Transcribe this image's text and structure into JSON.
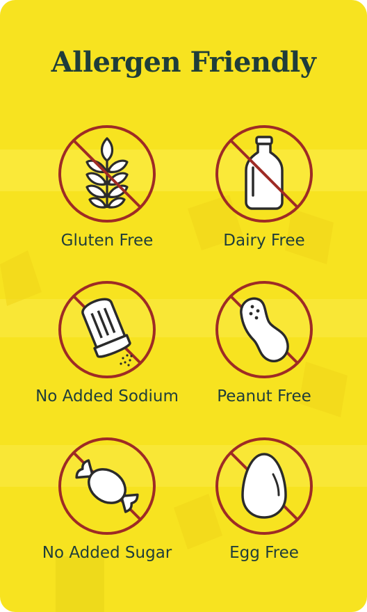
{
  "title": "Allergen Friendly",
  "colors": {
    "background": "#f7e320",
    "prohibit_ring": "#9e2b25",
    "text": "#1f3d3a",
    "icon_outline": "#2b2b2b",
    "icon_fill": "#ffffff"
  },
  "items": [
    {
      "label": "Gluten Free",
      "icon": "wheat-icon"
    },
    {
      "label": "Dairy Free",
      "icon": "milk-bottle-icon"
    },
    {
      "label": "No Added Sodium",
      "icon": "salt-shaker-icon"
    },
    {
      "label": "Peanut Free",
      "icon": "peanut-icon"
    },
    {
      "label": "No Added Sugar",
      "icon": "candy-icon"
    },
    {
      "label": "Egg Free",
      "icon": "egg-icon"
    }
  ]
}
